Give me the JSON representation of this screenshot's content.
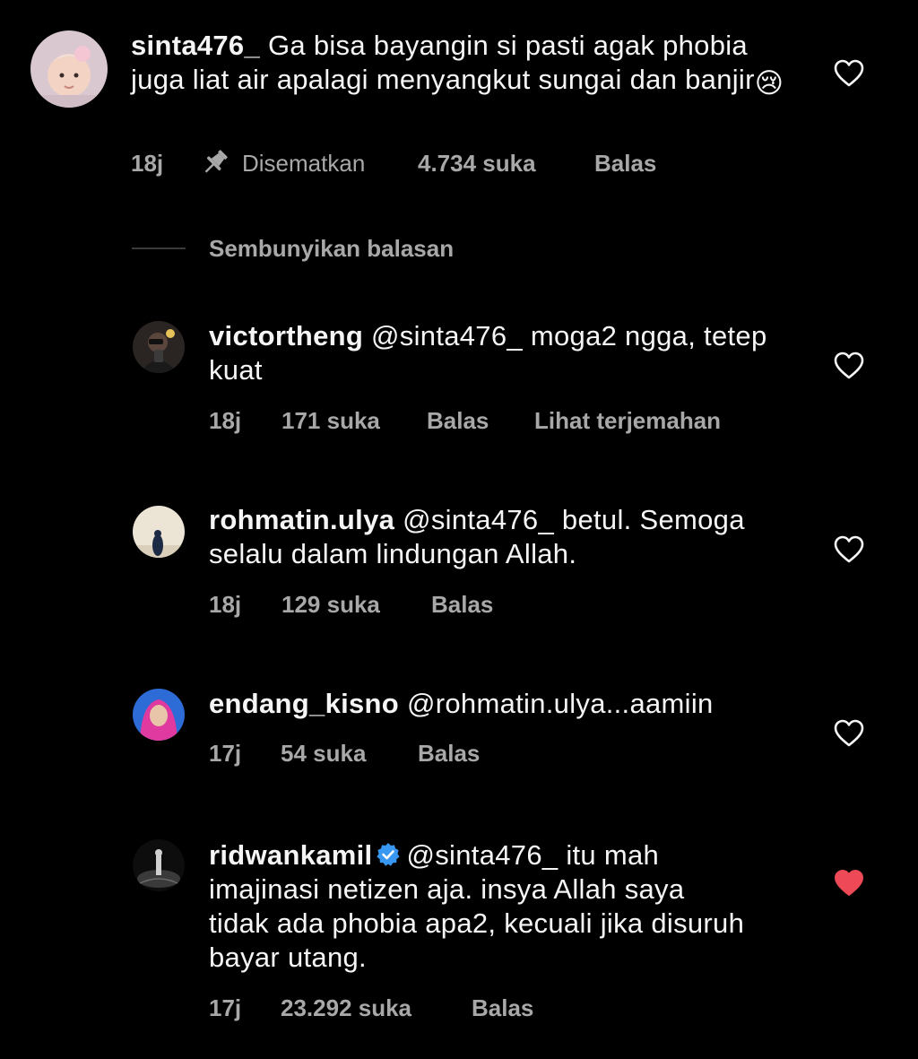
{
  "comments": [
    {
      "username": "sinta476_",
      "text": "Ga bisa bayangin si pasti agak phobia juga liat air apalagi menyangkut sungai dan banjir",
      "emoji": "😢",
      "time": "18j",
      "pinned_label": "Disematkan",
      "likes": "4.734 suka",
      "reply_label": "Balas",
      "liked": false
    }
  ],
  "hide_replies_label": "Sembunyikan balasan",
  "replies": [
    {
      "username": "victortheng",
      "mention": "@sinta476_",
      "text": "moga2 ngga, tetep kuat",
      "time": "18j",
      "likes": "171 suka",
      "reply_label": "Balas",
      "translate_label": "Lihat terjemahan",
      "liked": false
    },
    {
      "username": "rohmatin.ulya",
      "mention": "@sinta476_",
      "text": "betul. Semoga selalu dalam lindungan Allah.",
      "time": "18j",
      "likes": "129 suka",
      "reply_label": "Balas",
      "liked": false
    },
    {
      "username": "endang_kisno",
      "mention": "@rohmatin.ulya",
      "text": "...aamiin",
      "time": "17j",
      "likes": "54 suka",
      "reply_label": "Balas",
      "liked": false
    },
    {
      "username": "ridwankamil",
      "verified": true,
      "mention": "@sinta476_",
      "text": "itu mah imajinasi netizen aja. insya Allah saya tidak ada phobia apa2, kecuali jika disuruh bayar utang.",
      "time": "17j",
      "likes": "23.292 suka",
      "reply_label": "Balas",
      "liked": true
    }
  ],
  "colors": {
    "background": "#000000",
    "text": "#f5f5f5",
    "meta": "#a8a8a8",
    "liked_heart": "#ed4956",
    "verified": "#3897f0"
  },
  "icons": {
    "heart": "heart-outline-icon",
    "heart_liked": "heart-filled-icon",
    "pin": "pin-icon",
    "verified": "verified-badge-icon"
  }
}
